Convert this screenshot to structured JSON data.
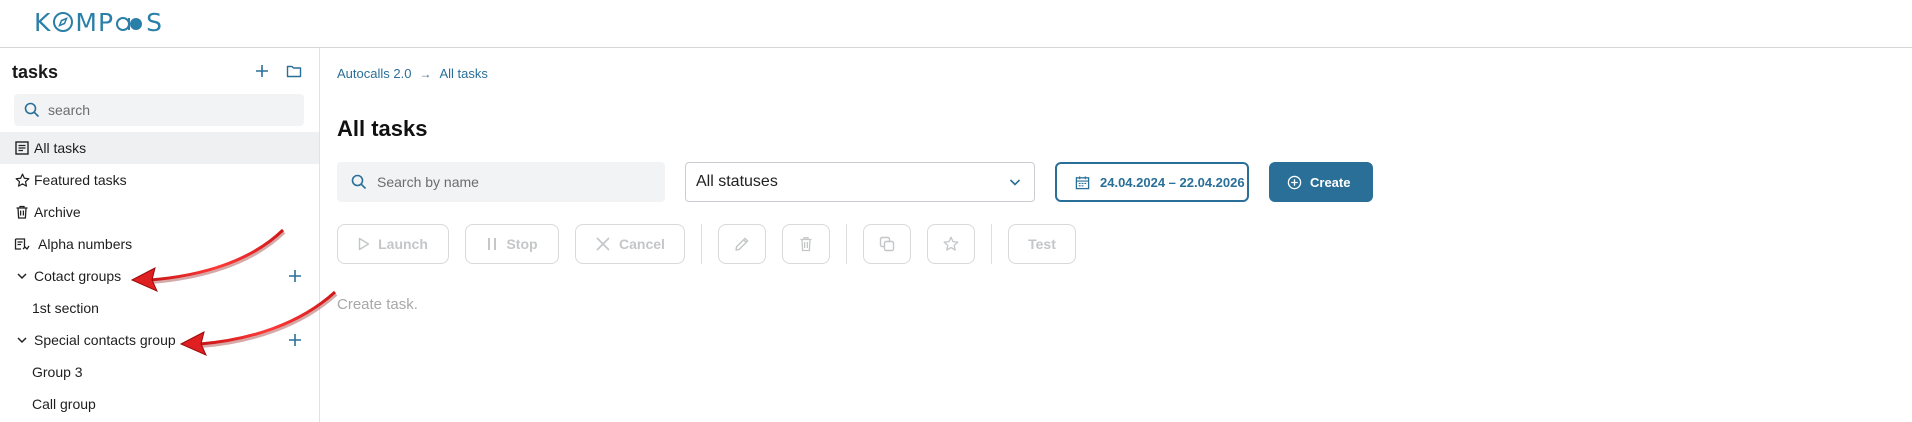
{
  "header": {
    "logo_text": "KOMPAS"
  },
  "sidebar": {
    "title": "tasks",
    "search_placeholder": "search",
    "items": [
      {
        "label": "All tasks",
        "icon": "list-icon",
        "active": true
      },
      {
        "label": "Featured tasks",
        "icon": "star-icon"
      },
      {
        "label": "Archive",
        "icon": "trash-icon"
      },
      {
        "label": "Alpha numbers",
        "icon": "alpha-numbers-icon"
      },
      {
        "label": "Cotact groups",
        "icon": "chevron-down-icon",
        "expandable": true
      },
      {
        "label": "1st section",
        "child": true
      },
      {
        "label": "Special contacts group",
        "icon": "chevron-down-icon",
        "expandable": true
      },
      {
        "label": "Group 3",
        "child": true
      },
      {
        "label": "Call group",
        "child": true
      }
    ]
  },
  "breadcrumb": {
    "items": [
      "Autocalls 2.0",
      "All tasks"
    ],
    "separator": "→"
  },
  "main": {
    "title": "All tasks",
    "search_placeholder": "Search by name",
    "status_select": "All statuses",
    "date_range": "24.04.2024 – 22.04.2026",
    "create_label": "Create",
    "toolbar": {
      "launch": "Launch",
      "stop": "Stop",
      "cancel": "Cancel",
      "test": "Test"
    },
    "empty_message": "Create task."
  },
  "colors": {
    "accent": "#2a6f98",
    "logo": "#2a7fa8",
    "disabled": "#c4c6c8",
    "annotation_arrow": "#e02020"
  }
}
